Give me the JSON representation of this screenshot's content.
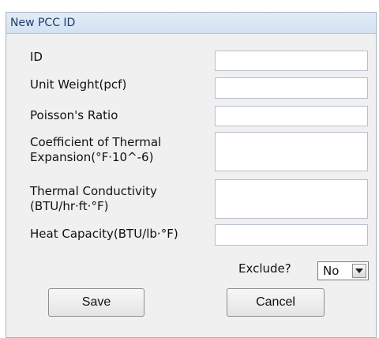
{
  "window": {
    "title": "New PCC ID"
  },
  "fields": [
    {
      "label": "ID",
      "value": ""
    },
    {
      "label": "Unit Weight(pcf)",
      "value": ""
    },
    {
      "label": "Poisson's Ratio",
      "value": ""
    },
    {
      "label": "Coefficient of Thermal\nExpansion(°F·10^-6)",
      "value": ""
    },
    {
      "label": "Thermal Conductivity\n(BTU/hr·ft·°F)",
      "value": ""
    },
    {
      "label": "Heat Capacity(BTU/lb·°F)",
      "value": ""
    }
  ],
  "exclude": {
    "label": "Exclude?",
    "value": "No"
  },
  "buttons": {
    "save": "Save",
    "cancel": "Cancel"
  }
}
